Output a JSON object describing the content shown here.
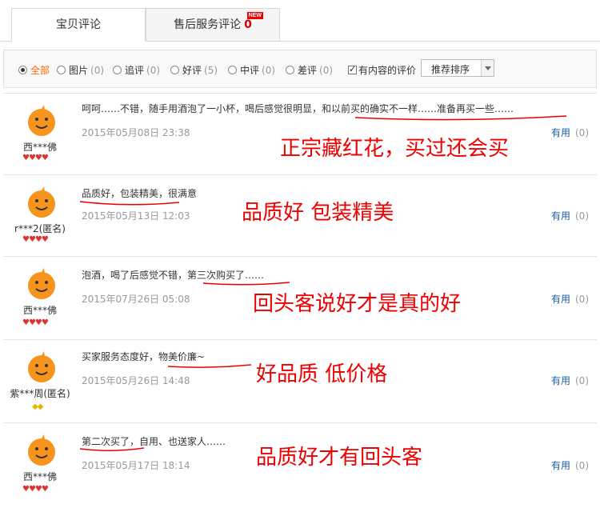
{
  "tabs": {
    "baby_comments": "宝贝评论",
    "after_sales": "售后服务评论",
    "after_sales_count": "0",
    "new_badge": "NEW"
  },
  "filters": [
    {
      "label": "全部",
      "count": "",
      "selected": true
    },
    {
      "label": "图片",
      "count": "(0)",
      "selected": false
    },
    {
      "label": "追评",
      "count": "(0)",
      "selected": false
    },
    {
      "label": "好评",
      "count": "(5)",
      "selected": false
    },
    {
      "label": "中评",
      "count": "(0)",
      "selected": false
    },
    {
      "label": "差评",
      "count": "(0)",
      "selected": false
    }
  ],
  "content_only_label": "有内容的评价",
  "sort_label": "推荐排序",
  "useful_label": "有用",
  "useful_count": "(0)",
  "reviews": [
    {
      "user": "西***佛",
      "comment": "呵呵……不错，随手用酒泡了一小杯，喝后感觉很明显，和以前买的确实不一样……准备再买一些……",
      "date": "2015年05月08日 23:38",
      "caption": "正宗藏红花，买过还会买",
      "rank": "hearts",
      "rank_count": 4
    },
    {
      "user": "r***2(匿名)",
      "comment": "品质好，包装精美，很满意",
      "date": "2015年05月13日 12:03",
      "caption": "品质好 包装精美",
      "rank": "hearts",
      "rank_count": 4
    },
    {
      "user": "西***佛",
      "comment": "泡酒，喝了后感觉不错，第三次购买了……",
      "date": "2015年07月26日 05:08",
      "caption": "回头客说好才是真的好",
      "rank": "hearts",
      "rank_count": 4
    },
    {
      "user": "紫***周(匿名)",
      "comment": "买家服务态度好，物美价廉~",
      "date": "2015年05月26日 14:48",
      "caption": "好品质 低价格",
      "rank": "diamonds",
      "rank_count": 2
    },
    {
      "user": "西***佛",
      "comment": "第二次买了，自用、也送家人……",
      "date": "2015年05月17日 18:14",
      "caption": "品质好才有回头客",
      "rank": "hearts",
      "rank_count": 4
    }
  ],
  "colors": {
    "accent_orange": "#f60",
    "annotation_red": "#e00",
    "link_blue": "#1c5fa8"
  }
}
